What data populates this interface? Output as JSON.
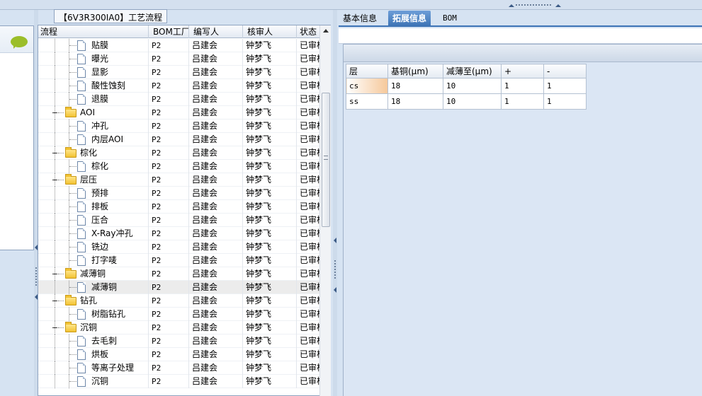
{
  "group_title": "【6V3R300IA0】工艺流程",
  "grid": {
    "columns": [
      "流程",
      "BOM工厂",
      "编写人",
      "核审人",
      "状态"
    ],
    "rows": [
      {
        "level": 2,
        "type": "file",
        "name": "贴膜",
        "bom": "P2",
        "writer": "吕建会",
        "checker": "钟梦飞",
        "status": "已审核"
      },
      {
        "level": 2,
        "type": "file",
        "name": "曝光",
        "bom": "P2",
        "writer": "吕建会",
        "checker": "钟梦飞",
        "status": "已审核"
      },
      {
        "level": 2,
        "type": "file",
        "name": "显影",
        "bom": "P2",
        "writer": "吕建会",
        "checker": "钟梦飞",
        "status": "已审核"
      },
      {
        "level": 2,
        "type": "file",
        "name": "酸性蚀刻",
        "bom": "P2",
        "writer": "吕建会",
        "checker": "钟梦飞",
        "status": "已审核"
      },
      {
        "level": 2,
        "type": "file",
        "name": "退膜",
        "bom": "P2",
        "writer": "吕建会",
        "checker": "钟梦飞",
        "status": "已审核"
      },
      {
        "level": 1,
        "type": "folder",
        "name": "AOI",
        "bom": "P2",
        "writer": "吕建会",
        "checker": "钟梦飞",
        "status": "已审核"
      },
      {
        "level": 2,
        "type": "file",
        "name": "冲孔",
        "bom": "P2",
        "writer": "吕建会",
        "checker": "钟梦飞",
        "status": "已审核"
      },
      {
        "level": 2,
        "type": "file",
        "name": "内层AOI",
        "bom": "P2",
        "writer": "吕建会",
        "checker": "钟梦飞",
        "status": "已审核"
      },
      {
        "level": 1,
        "type": "folder",
        "name": "棕化",
        "bom": "P2",
        "writer": "吕建会",
        "checker": "钟梦飞",
        "status": "已审核"
      },
      {
        "level": 2,
        "type": "file",
        "name": "棕化",
        "bom": "P2",
        "writer": "吕建会",
        "checker": "钟梦飞",
        "status": "已审核"
      },
      {
        "level": 1,
        "type": "folder",
        "name": "层压",
        "bom": "P2",
        "writer": "吕建会",
        "checker": "钟梦飞",
        "status": "已审核"
      },
      {
        "level": 2,
        "type": "file",
        "name": "预排",
        "bom": "P2",
        "writer": "吕建会",
        "checker": "钟梦飞",
        "status": "已审核"
      },
      {
        "level": 2,
        "type": "file",
        "name": "排板",
        "bom": "P2",
        "writer": "吕建会",
        "checker": "钟梦飞",
        "status": "已审核"
      },
      {
        "level": 2,
        "type": "file",
        "name": "压合",
        "bom": "P2",
        "writer": "吕建会",
        "checker": "钟梦飞",
        "status": "已审核"
      },
      {
        "level": 2,
        "type": "file",
        "name": "X-Ray冲孔",
        "bom": "P2",
        "writer": "吕建会",
        "checker": "钟梦飞",
        "status": "已审核"
      },
      {
        "level": 2,
        "type": "file",
        "name": "铣边",
        "bom": "P2",
        "writer": "吕建会",
        "checker": "钟梦飞",
        "status": "已审核"
      },
      {
        "level": 2,
        "type": "file",
        "name": "打字唛",
        "bom": "P2",
        "writer": "吕建会",
        "checker": "钟梦飞",
        "status": "已审核"
      },
      {
        "level": 1,
        "type": "folder",
        "name": "减薄铜",
        "bom": "P2",
        "writer": "吕建会",
        "checker": "钟梦飞",
        "status": "已审核"
      },
      {
        "level": 2,
        "type": "file",
        "name": "减薄铜",
        "bom": "P2",
        "writer": "吕建会",
        "checker": "钟梦飞",
        "status": "已审核",
        "selected": true
      },
      {
        "level": 1,
        "type": "folder",
        "name": "钻孔",
        "bom": "P2",
        "writer": "吕建会",
        "checker": "钟梦飞",
        "status": "已审核"
      },
      {
        "level": 2,
        "type": "file",
        "name": "树脂钻孔",
        "bom": "P2",
        "writer": "吕建会",
        "checker": "钟梦飞",
        "status": "已审核"
      },
      {
        "level": 1,
        "type": "folder",
        "name": "沉铜",
        "bom": "P2",
        "writer": "吕建会",
        "checker": "钟梦飞",
        "status": "已审核"
      },
      {
        "level": 2,
        "type": "file",
        "name": "去毛刺",
        "bom": "P2",
        "writer": "吕建会",
        "checker": "钟梦飞",
        "status": "已审核"
      },
      {
        "level": 2,
        "type": "file",
        "name": "烘板",
        "bom": "P2",
        "writer": "吕建会",
        "checker": "钟梦飞",
        "status": "已审核"
      },
      {
        "level": 2,
        "type": "file",
        "name": "等离子处理",
        "bom": "P2",
        "writer": "吕建会",
        "checker": "钟梦飞",
        "status": "已审核"
      },
      {
        "level": 2,
        "type": "file",
        "name": "沉铜",
        "bom": "P2",
        "writer": "吕建会",
        "checker": "钟梦飞",
        "status": "已审核"
      }
    ]
  },
  "tabs": [
    {
      "label": "基本信息",
      "active": false
    },
    {
      "label": "拓展信息",
      "active": true
    },
    {
      "label": "BOM",
      "active": false
    }
  ],
  "ext_table": {
    "headers": [
      "层",
      "基铜(μm)",
      "减薄至(μm)",
      "+",
      "-"
    ],
    "rows": [
      [
        "cs",
        "18",
        "10",
        "1",
        "1"
      ],
      [
        "ss",
        "18",
        "10",
        "1",
        "1"
      ]
    ]
  },
  "icons": {
    "chat": "chat-bubble-icon",
    "file": "file-icon",
    "folder": "folder-icon"
  },
  "colors": {
    "accent": "#3c73b5",
    "chat": "#9bbe2a",
    "highlight": "#f6c89a"
  }
}
